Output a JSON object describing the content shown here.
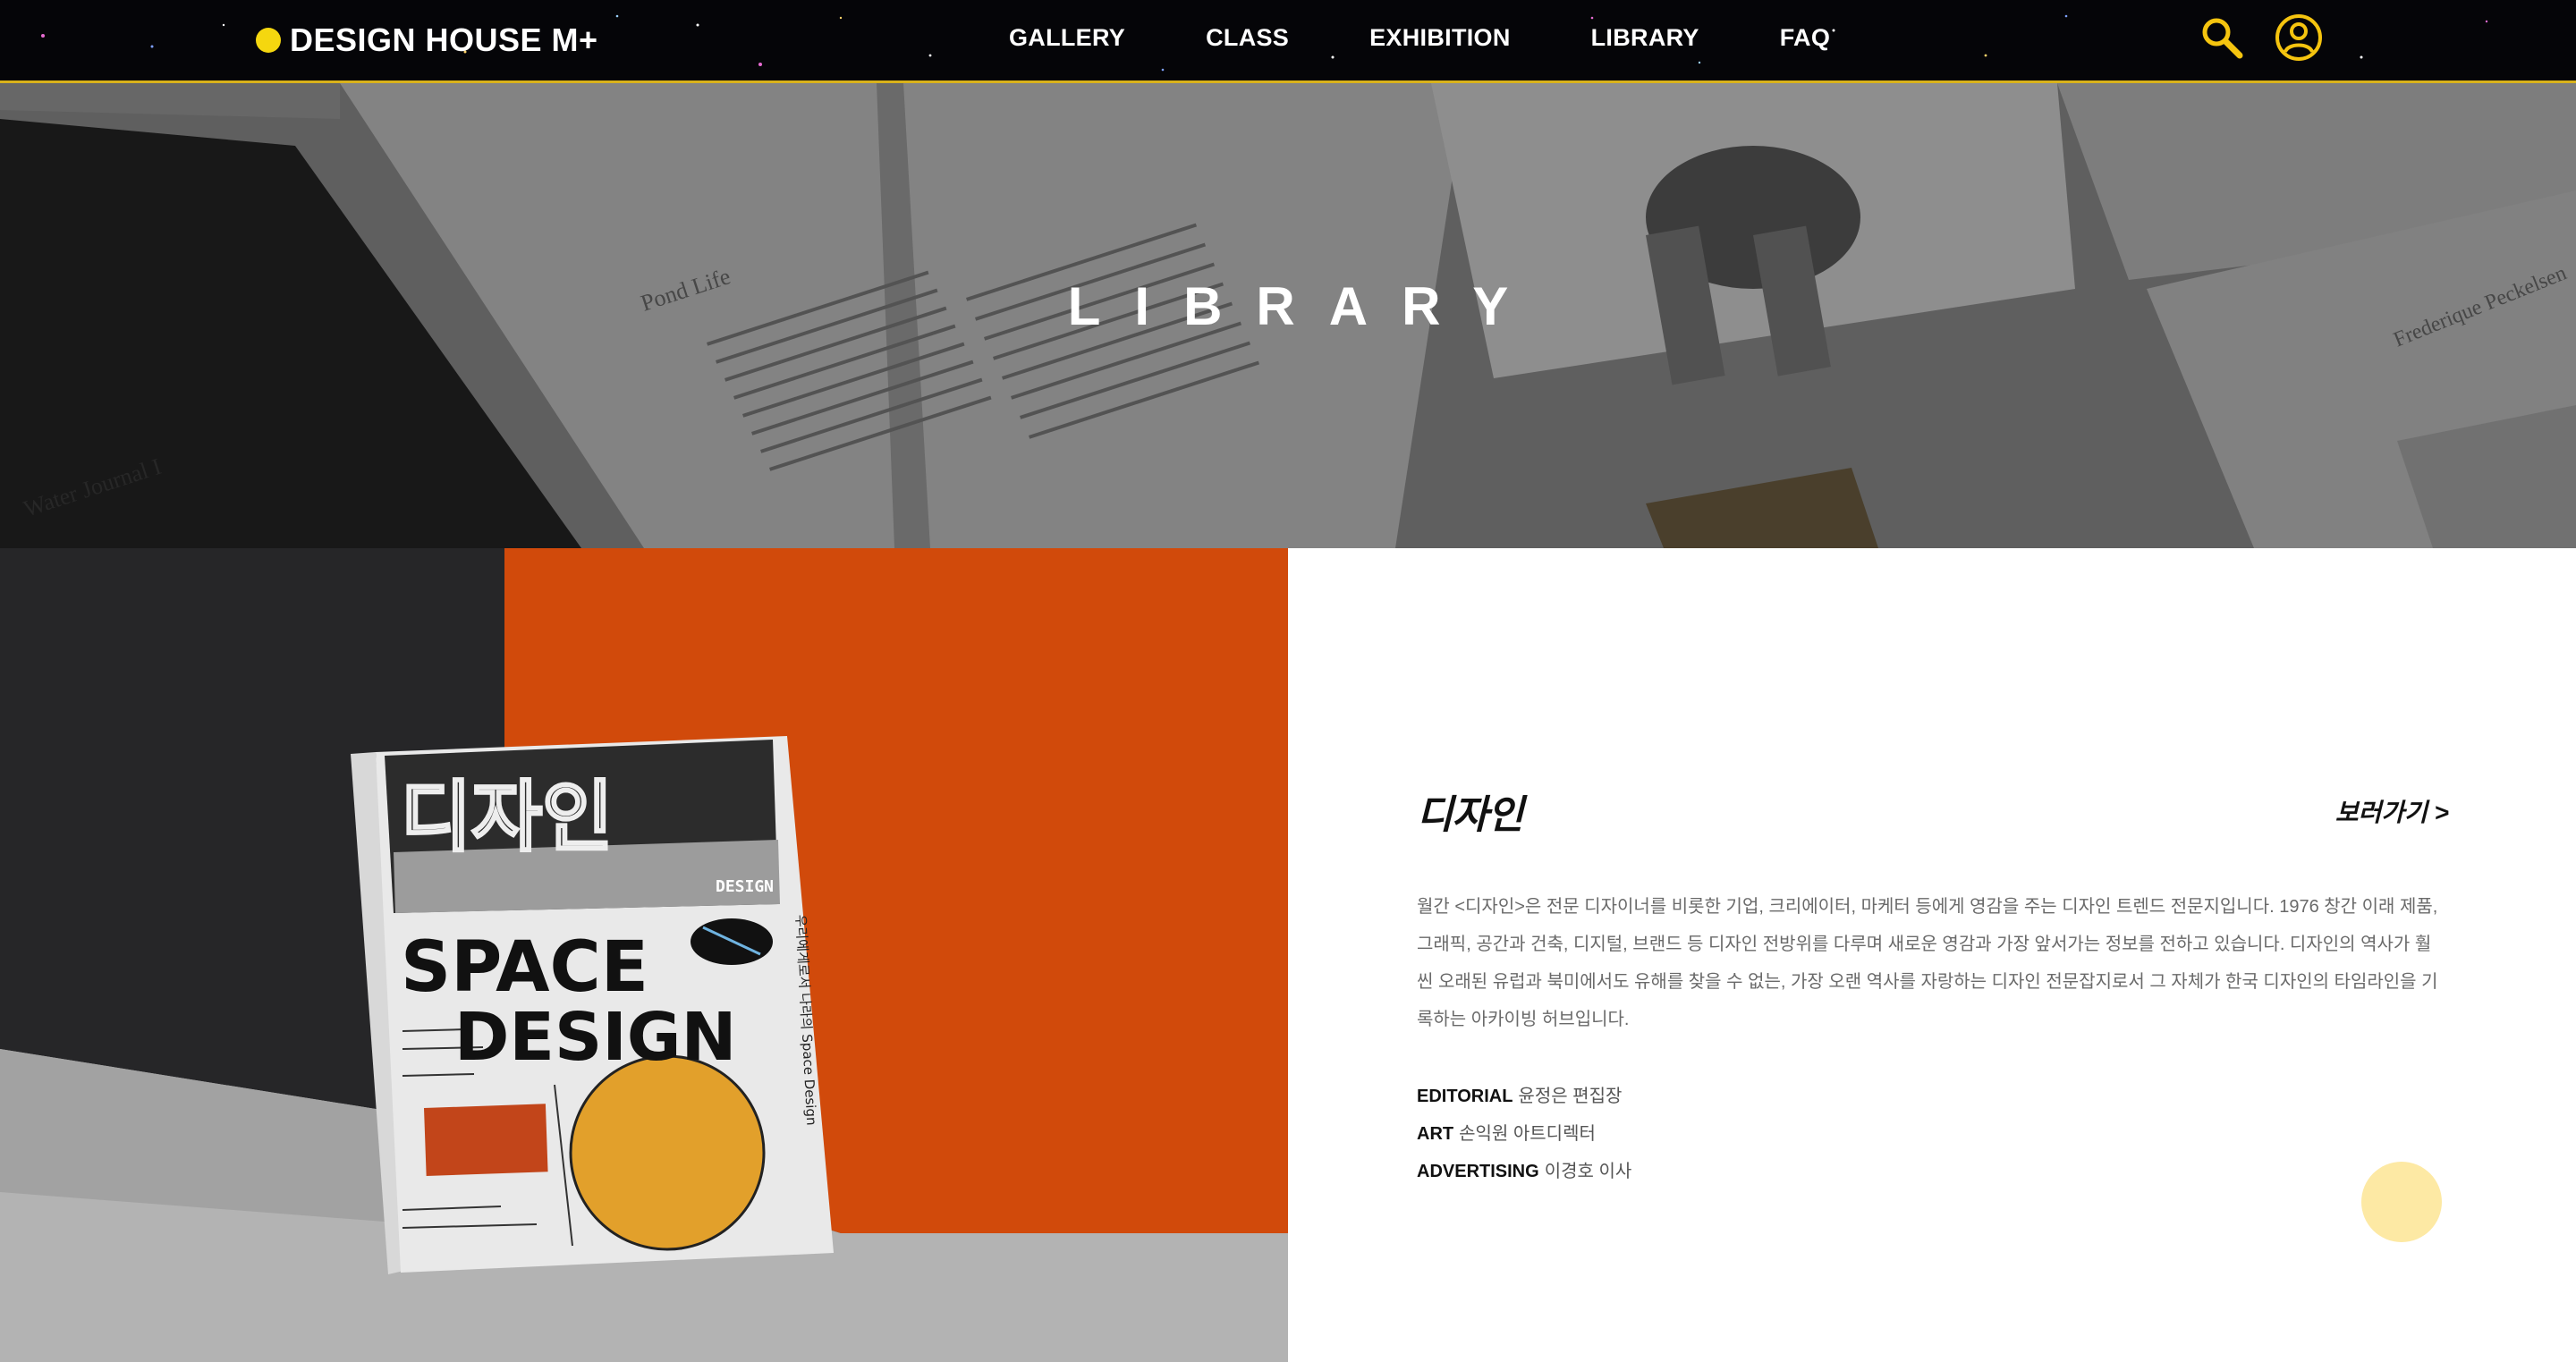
{
  "brand": {
    "logo_text": "DESIGN HOUSE M+",
    "accent_color": "#f5d70f",
    "nav_border_color": "#d9b21a"
  },
  "nav": {
    "links": [
      "GALLERY",
      "CLASS",
      "EXHIBITION",
      "LIBRARY",
      "FAQ"
    ],
    "icons": [
      "search-icon",
      "user-icon"
    ]
  },
  "hero": {
    "title": "LIBRARY",
    "background_texts": [
      "Pond Life",
      "Water Journal I",
      "Frederique Peckelsen"
    ]
  },
  "magazine": {
    "title": "디자인",
    "view_link": "보러가기 >",
    "description": "월간 <디자인>은 전문 디자이너를 비롯한 기업, 크리에이터, 마케터 등에게 영감을 주는 디자인 트렌드 전문지입니다. 1976 창간 이래 제품, 그래픽, 공간과 건축, 디지털, 브랜드 등 디자인 전방위를 다루며 새로운 영감과 가장 앞서가는 정보를 전하고 있습니다. 디자인의 역사가 훨씬 오래된 유럽과 북미에서도 유해를 찾을 수 없는, 가장 오랜 역사를 자랑하는 디자인 전문잡지로서 그 자체가 한국 디자인의 타임라인을 기록하는 아카이빙 허브입니다.",
    "credits": [
      {
        "role": "EDITORIAL",
        "name": "윤정은 편집장"
      },
      {
        "role": "ART",
        "name": "손익원 아트디렉터"
      },
      {
        "role": "ADVERTISING",
        "name": "이경호 이사"
      }
    ],
    "cover": {
      "title": "디자인",
      "subtitle": "DESIGN",
      "headline_1": "SPACE",
      "headline_2": "DESIGN",
      "spine_text": "우리에게로서 나라의 Space Design"
    }
  },
  "colors": {
    "orange_wall": "#d14a0b",
    "dark_wall": "#262628",
    "floor": "#b0b0b0",
    "float_circle": "#fde9a4"
  }
}
